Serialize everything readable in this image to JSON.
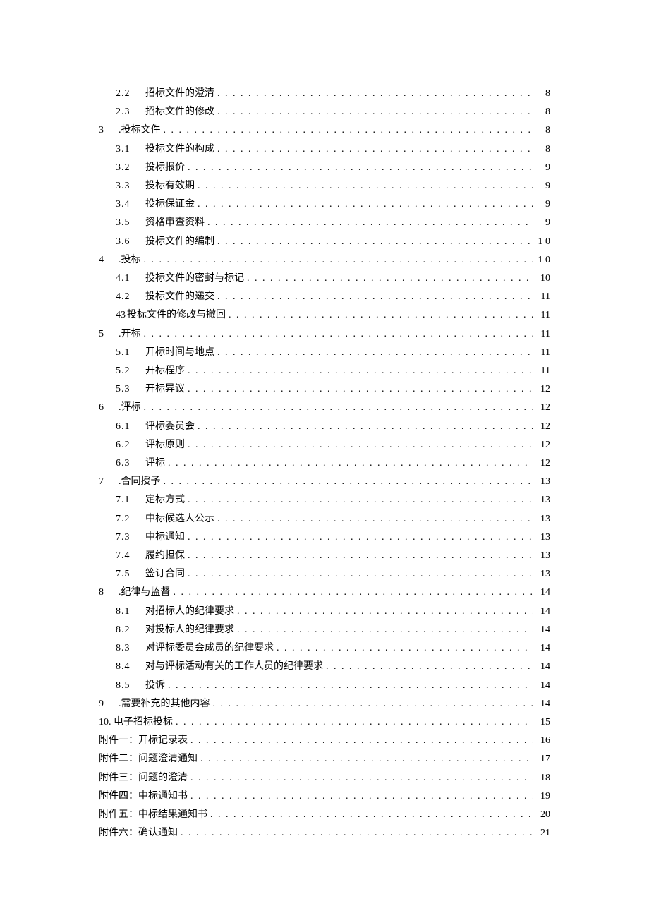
{
  "toc": [
    {
      "indent": 1,
      "num": "2.2",
      "label": "招标文件的澄清",
      "page": "8"
    },
    {
      "indent": 1,
      "num": "2.3",
      "label": "招标文件的修改",
      "page": "8"
    },
    {
      "indent": 0,
      "num": "3",
      "label": ".投标文件",
      "page": "8"
    },
    {
      "indent": 1,
      "num": "3.1",
      "label": "投标文件的构成",
      "page": "8"
    },
    {
      "indent": 1,
      "num": "3.2",
      "label": "投标报价",
      "page": "9"
    },
    {
      "indent": 1,
      "num": "3.3",
      "label": "投标有效期",
      "page": "9"
    },
    {
      "indent": 1,
      "num": "3.4",
      "label": "投标保证金",
      "page": "9"
    },
    {
      "indent": 1,
      "num": "3.5",
      "label": "资格审查资料",
      "page": "9"
    },
    {
      "indent": 1,
      "num": "3.6",
      "label": "投标文件的编制",
      "page": "1 0"
    },
    {
      "indent": 0,
      "num": "4",
      "label": ".投标",
      "page": "1 0"
    },
    {
      "indent": 1,
      "num": "4.1",
      "label": "投标文件的密封与标记",
      "page": "10"
    },
    {
      "indent": 1,
      "num": "4.2",
      "label": "投标文件的递交",
      "page": "11"
    },
    {
      "indent": 1,
      "num": "43",
      "label": "投标文件的修改与撤回",
      "page": "11",
      "nospace": true
    },
    {
      "indent": 0,
      "num": "5",
      "label": ".开标",
      "page": "11"
    },
    {
      "indent": 1,
      "num": "5.1",
      "label": "开标时间与地点",
      "page": "11"
    },
    {
      "indent": 1,
      "num": "5.2",
      "label": "开标程序",
      "page": "11"
    },
    {
      "indent": 1,
      "num": "5.3",
      "label": "开标异议",
      "page": "12"
    },
    {
      "indent": 0,
      "num": "6",
      "label": ".评标",
      "page": "12"
    },
    {
      "indent": 1,
      "num": "6.1",
      "label": "评标委员会",
      "page": "12"
    },
    {
      "indent": 1,
      "num": "6.2",
      "label": "评标原则",
      "page": "12"
    },
    {
      "indent": 1,
      "num": "6.3",
      "label": "评标",
      "page": "12"
    },
    {
      "indent": 0,
      "num": "7",
      "label": ".合同授予",
      "page": "13"
    },
    {
      "indent": 1,
      "num": "7.1",
      "label": "定标方式",
      "page": "13"
    },
    {
      "indent": 1,
      "num": "7.2",
      "label": "中标候选人公示",
      "page": "13"
    },
    {
      "indent": 1,
      "num": "7.3",
      "label": "中标通知",
      "page": "13"
    },
    {
      "indent": 1,
      "num": "7.4",
      "label": "履约担保",
      "page": "13"
    },
    {
      "indent": 1,
      "num": "7.5",
      "label": "签订合同",
      "page": "13"
    },
    {
      "indent": 0,
      "num": "8",
      "label": ".纪律与监督",
      "page": "14"
    },
    {
      "indent": 1,
      "num": "8.1",
      "label": "对招标人的纪律要求",
      "page": "14"
    },
    {
      "indent": 1,
      "num": "8.2",
      "label": "对投标人的纪律要求",
      "page": "14"
    },
    {
      "indent": 1,
      "num": "8.3",
      "label": "对评标委员会成员的纪律要求",
      "page": "14"
    },
    {
      "indent": 1,
      "num": "8.4",
      "label": "对与评标活动有关的工作人员的纪律要求",
      "page": "14"
    },
    {
      "indent": 1,
      "num": "8.5",
      "label": "投诉",
      "page": "14"
    },
    {
      "indent": 0,
      "num": "9",
      "label": ".需要补充的其他内容",
      "page": "14"
    },
    {
      "indent": 0,
      "num": "",
      "label": "10. 电子招标投标",
      "page": "15"
    },
    {
      "indent": 0,
      "num": "",
      "label": "附件一：开标记录表",
      "page": "16"
    },
    {
      "indent": 0,
      "num": "",
      "label": "附件二：问题澄清通知",
      "page": "17"
    },
    {
      "indent": 0,
      "num": "",
      "label": "附件三：问题的澄清",
      "page": "18"
    },
    {
      "indent": 0,
      "num": "",
      "label": "附件四：中标通知书",
      "page": "19"
    },
    {
      "indent": 0,
      "num": "",
      "label": "附件五：中标结果通知书",
      "page": "20"
    },
    {
      "indent": 0,
      "num": "",
      "label": "附件六：确认通知",
      "page": "21"
    }
  ]
}
